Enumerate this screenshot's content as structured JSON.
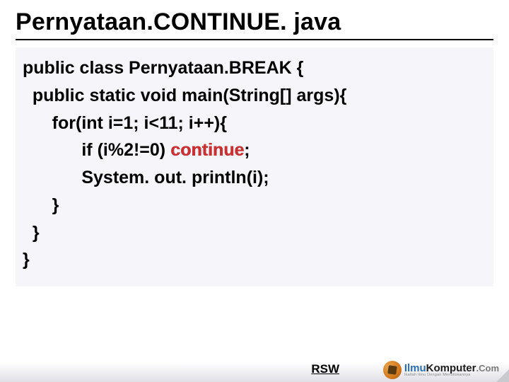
{
  "title": "Pernyataan.CONTINUE. java",
  "code": {
    "l1": "public class Pernyataan.BREAK {",
    "l2": "  public static void main(String[] args){",
    "l3": "      for(int i=1; i<11; i++){",
    "l4a": "            if (i%2!=0) ",
    "l4b": "continue",
    "l4c": ";",
    "l5": "            System. out. println(i);",
    "l6": "      }",
    "l7": "  }",
    "l8": "}"
  },
  "footer": {
    "rsw": "RSW",
    "logo_ilmu": "Ilmu",
    "logo_komputer": "Komputer",
    "logo_com": ".Com",
    "logo_sub": "Ikatlah Ilmu Dengan Menuliskannya"
  }
}
